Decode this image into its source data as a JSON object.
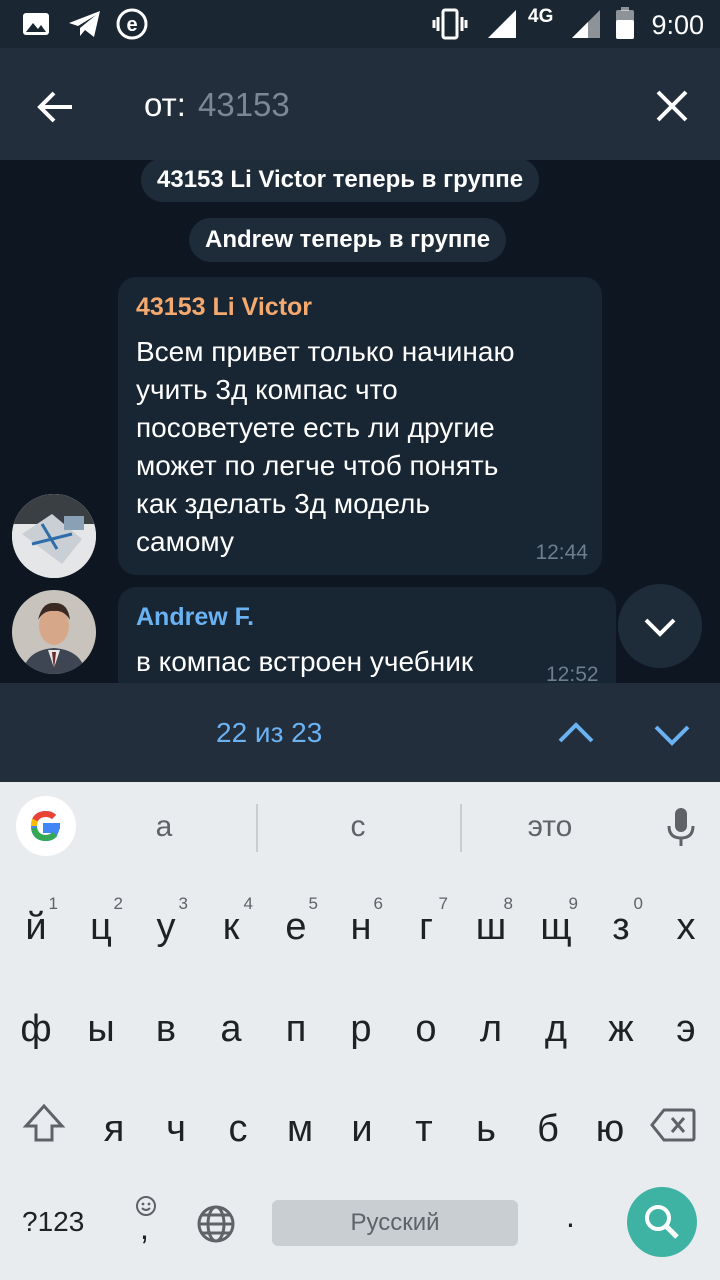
{
  "status_bar": {
    "time": "9:00",
    "network": "4G"
  },
  "header": {
    "prefix": "от:",
    "query": "43153"
  },
  "chat": {
    "service_messages": [
      {
        "text": "43153 Li Victor теперь в группе"
      },
      {
        "text": "Andrew теперь в группе"
      }
    ],
    "messages": [
      {
        "sender": "43153 Li Victor",
        "sender_color": "#f4a96e",
        "lines": [
          "Всем привет только начинаю",
          "учить 3д компас что",
          "посоветуете есть ли другие",
          "может по легче чтоб понять",
          "как зделать 3д модель",
          "самому"
        ],
        "time": "12:44"
      },
      {
        "sender": "Andrew F.",
        "sender_color": "#6ab2f2",
        "lines": [
          "в компас встроен учебник"
        ],
        "time": "12:52"
      }
    ]
  },
  "search_nav": {
    "counter": "22 из 23"
  },
  "keyboard": {
    "suggestions": [
      "а",
      "с",
      "это"
    ],
    "row1": [
      {
        "k": "й",
        "h": "1"
      },
      {
        "k": "ц",
        "h": "2"
      },
      {
        "k": "у",
        "h": "3"
      },
      {
        "k": "к",
        "h": "4"
      },
      {
        "k": "е",
        "h": "5"
      },
      {
        "k": "н",
        "h": "6"
      },
      {
        "k": "г",
        "h": "7"
      },
      {
        "k": "ш",
        "h": "8"
      },
      {
        "k": "щ",
        "h": "9"
      },
      {
        "k": "з",
        "h": "0"
      },
      {
        "k": "х",
        "h": ""
      }
    ],
    "row2": [
      "ф",
      "ы",
      "в",
      "а",
      "п",
      "р",
      "о",
      "л",
      "д",
      "ж",
      "э"
    ],
    "row3": [
      "я",
      "ч",
      "с",
      "м",
      "и",
      "т",
      "ь",
      "б",
      "ю"
    ],
    "symbols_label": "?123",
    "comma": ",",
    "period": ".",
    "space_label": "Русский"
  }
}
